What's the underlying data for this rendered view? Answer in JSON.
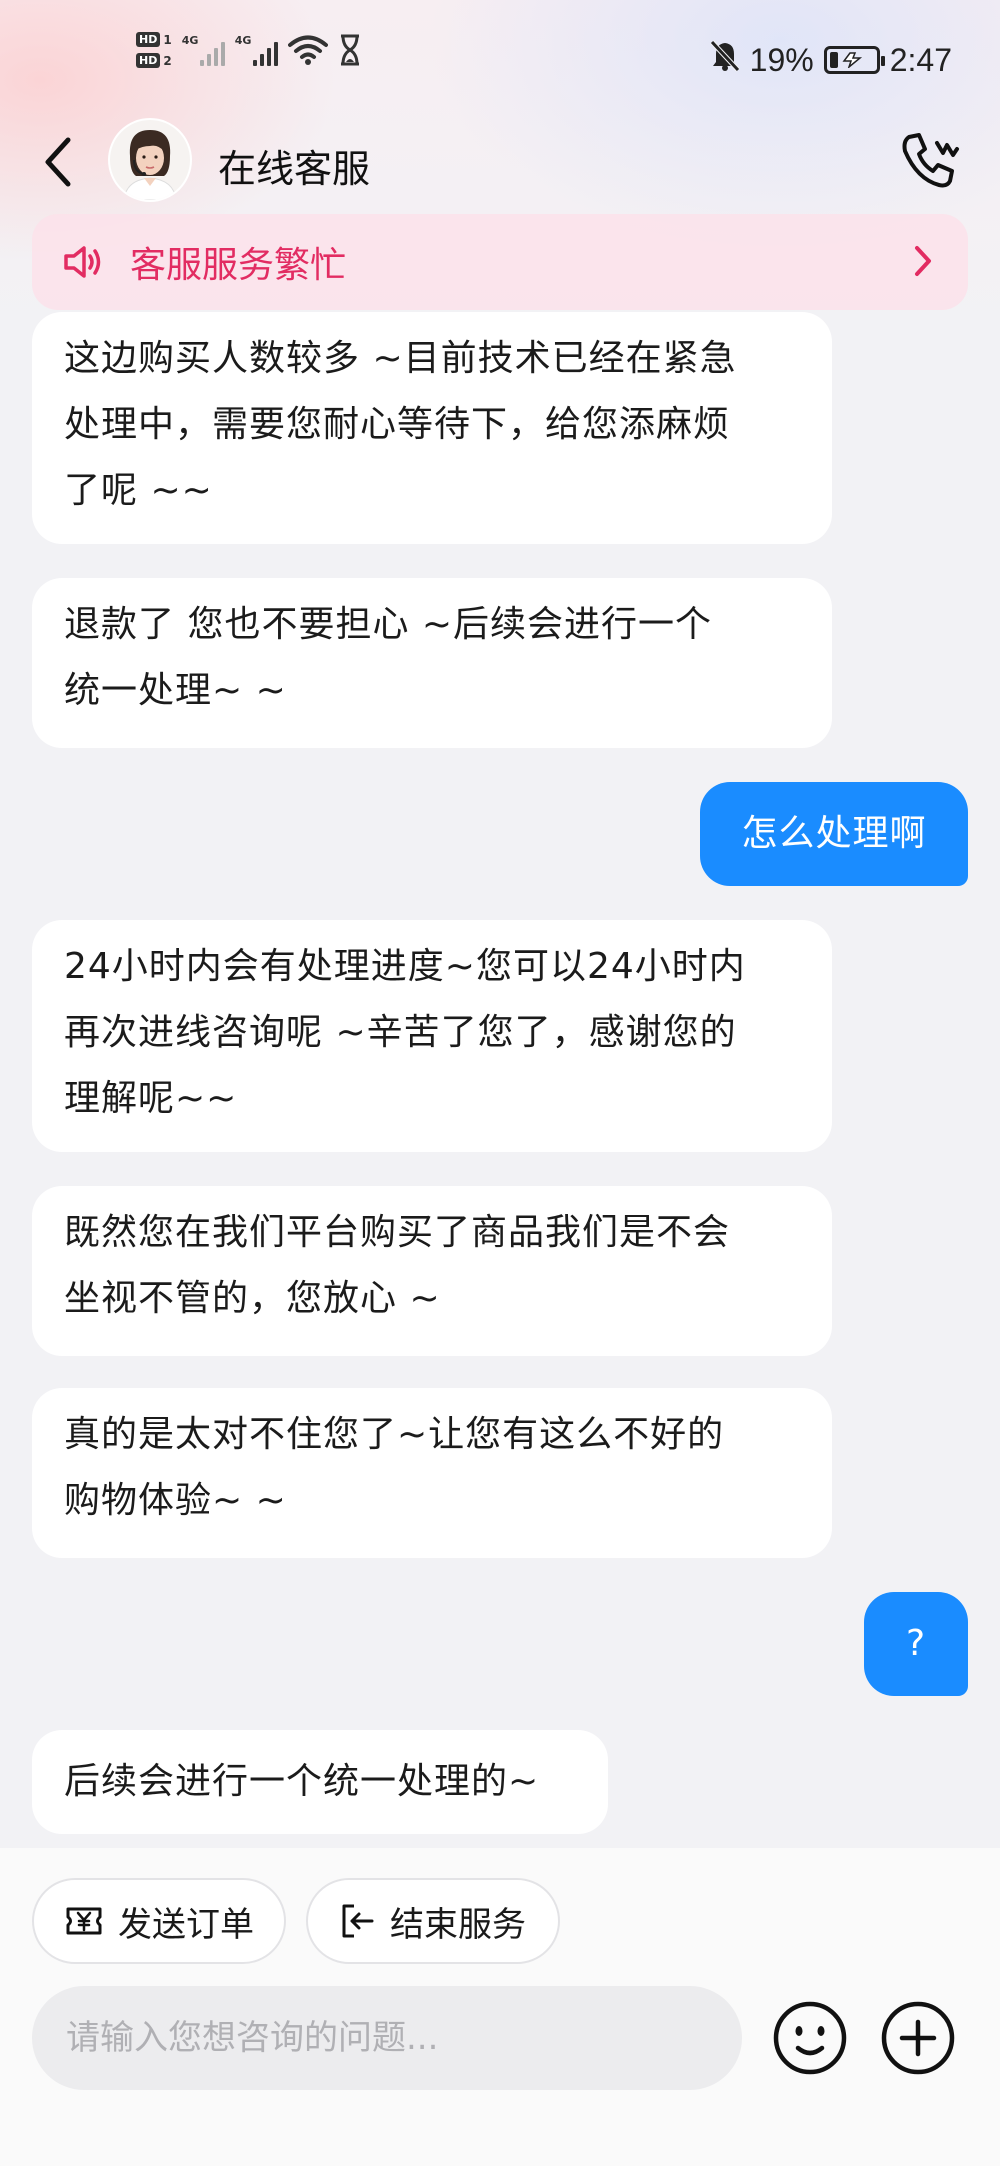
{
  "status_bar": {
    "hd1": "HD",
    "hd1_num": "1",
    "hd2": "HD",
    "hd2_num": "2",
    "net1": "4G",
    "net2": "4G",
    "battery_pct": "19%",
    "battery_level": 0.19,
    "time": "2:47"
  },
  "header": {
    "title": "在线客服"
  },
  "notice": {
    "text": "客服服务繁忙"
  },
  "messages": [
    {
      "side": "in",
      "lines": [
        "这边购买人数较多 ~目前技术已经在紧急",
        "处理中，需要您耐心等待下，给您添麻烦",
        "了呢 ~~"
      ]
    },
    {
      "side": "in",
      "lines": [
        "退款了 您也不要担心 ~后续会进行一个",
        "统一处理~ ~"
      ]
    },
    {
      "side": "out",
      "lines": [
        "怎么处理啊"
      ]
    },
    {
      "side": "in",
      "lines": [
        "24小时内会有处理进度~您可以24小时内",
        "再次进线咨询呢 ~辛苦了您了，感谢您的",
        "理解呢~~"
      ]
    },
    {
      "side": "in",
      "lines": [
        "既然您在我们平台购买了商品我们是不会",
        "坐视不管的，您放心 ~"
      ]
    },
    {
      "side": "in",
      "lines": [
        "真的是太对不住您了~让您有这么不好的",
        "购物体验~ ~"
      ]
    },
    {
      "side": "out",
      "lines": [
        "?"
      ]
    },
    {
      "side": "in",
      "lines": [
        "后续会进行一个统一处理的~"
      ]
    }
  ],
  "actions": {
    "send_order": "发送订单",
    "end_service": "结束服务"
  },
  "input": {
    "placeholder": "请输入您想咨询的问题...",
    "value": ""
  },
  "colors": {
    "accent_blue": "#1a8cff",
    "notice_red": "#e22c62"
  },
  "icons": {
    "back": "chevron-left-icon",
    "call": "phone-call-icon",
    "speaker": "speaker-icon",
    "send_order": "yuan-ticket-icon",
    "end_service": "exit-icon",
    "emoji": "smiley-icon",
    "plus": "plus-circle-icon"
  }
}
